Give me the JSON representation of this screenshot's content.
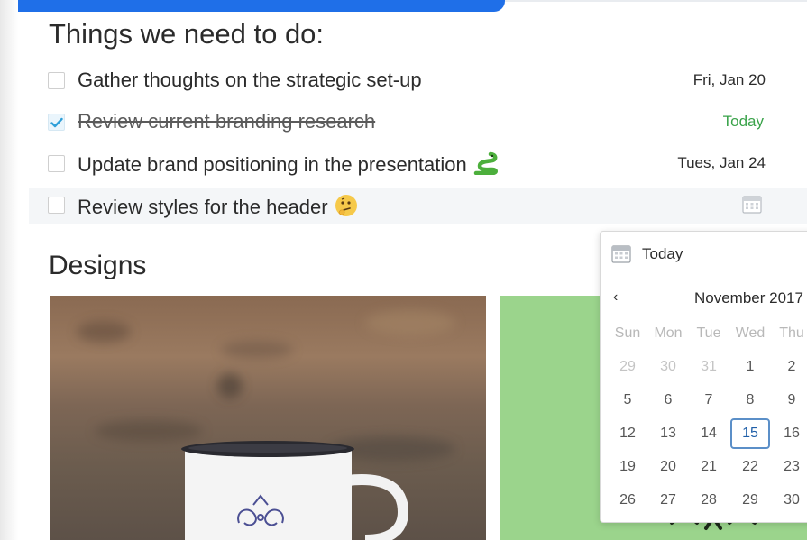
{
  "todo": {
    "heading": "Things we need to do:",
    "tasks": [
      {
        "label": "Gather thoughts on the strategic set-up",
        "due": "Fri, Jan 20",
        "done": false
      },
      {
        "label": "Review current branding research",
        "due": "Today",
        "done": true
      },
      {
        "label": "Update brand positioning in the presentation",
        "due": "Tues, Jan 24",
        "done": false,
        "emoji": "snake"
      },
      {
        "label": "Review styles for the header",
        "due": "",
        "done": false,
        "emoji": "thinking-face"
      }
    ]
  },
  "designs": {
    "heading": "Designs"
  },
  "datepicker": {
    "today_label": "Today",
    "prev_symbol": "‹",
    "month_label": "November 2017",
    "weekdays": [
      "Sun",
      "Mon",
      "Tue",
      "Wed",
      "Thu"
    ],
    "weeks": [
      [
        "29",
        "30",
        "31",
        "1",
        "2"
      ],
      [
        "5",
        "6",
        "7",
        "8",
        "9"
      ],
      [
        "12",
        "13",
        "14",
        "15",
        "16"
      ],
      [
        "19",
        "20",
        "21",
        "22",
        "23"
      ],
      [
        "26",
        "27",
        "28",
        "29",
        "30"
      ]
    ],
    "selected": "15"
  },
  "colors": {
    "accent_bar": "#1f6fe8",
    "today_green": "#3aa34a",
    "selected_date_border": "#5b8fc8",
    "design_panel_green": "#9bd48c"
  }
}
